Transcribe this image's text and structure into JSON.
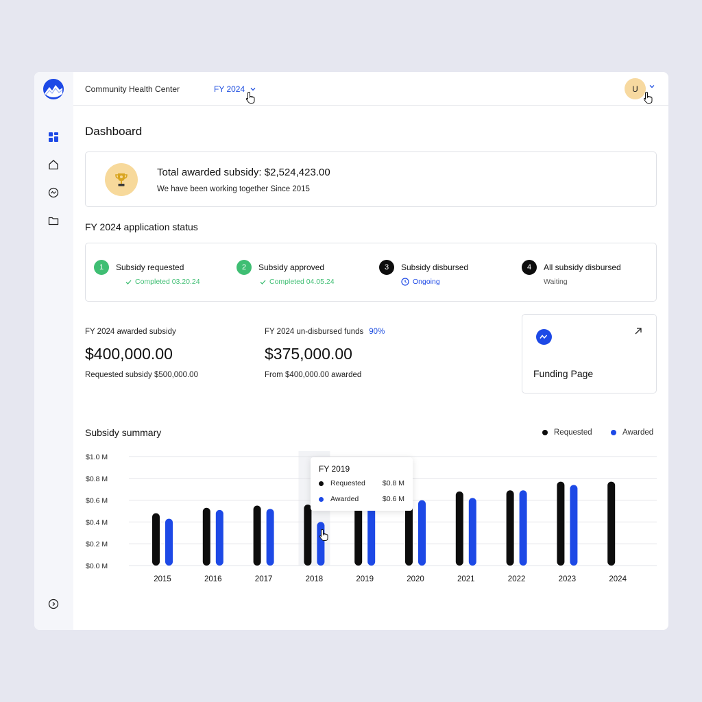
{
  "header": {
    "org_name": "Community Health Center",
    "fy_selected": "FY 2024",
    "avatar_initial": "U"
  },
  "sidebar": {
    "items": [
      {
        "icon": "dashboard-icon"
      },
      {
        "icon": "home-icon"
      },
      {
        "icon": "activity-icon"
      },
      {
        "icon": "folder-icon"
      }
    ],
    "bottom_icon": "expand-icon"
  },
  "page_title": "Dashboard",
  "total_card": {
    "title": "Total awarded subsidy: $2,524,423.00",
    "subtitle": "We have been working together Since 2015",
    "icon": "trophy-icon"
  },
  "application_status": {
    "title": "FY 2024 application status",
    "steps": [
      {
        "number": "1",
        "title": "Subsidy requested",
        "status": "Completed 03.20.24",
        "state": "completed"
      },
      {
        "number": "2",
        "title": "Subsidy approved",
        "status": "Completed 04.05.24",
        "state": "completed"
      },
      {
        "number": "3",
        "title": "Subsidy disbursed",
        "status": "Ongoing",
        "state": "ongoing"
      },
      {
        "number": "4",
        "title": "All subsidy disbursed",
        "status": "Waiting",
        "state": "waiting"
      }
    ]
  },
  "stats": {
    "awarded": {
      "label": "FY 2024 awarded subsidy",
      "value": "$400,000.00",
      "sub": "Requested subsidy $500,000.00"
    },
    "undisbursed": {
      "label": "FY 2024 un-disbursed funds",
      "percent": "90%",
      "value": "$375,000.00",
      "sub": "From $400,000.00 awarded"
    }
  },
  "funding_card": {
    "title": "Funding Page"
  },
  "summary": {
    "title": "Subsidy summary",
    "legend": {
      "requested": "Requested",
      "awarded": "Awarded"
    },
    "tooltip": {
      "title": "FY 2019",
      "requested_label": "Requested",
      "requested_value": "$0.8 M",
      "awarded_label": "Awarded",
      "awarded_value": "$0.6 M"
    }
  },
  "colors": {
    "requested": "#0d0d0d",
    "awarded": "#1d49e6",
    "completed": "#3fbe73",
    "ongoing": "#1d49e6",
    "accent": "#1f4fe0"
  },
  "chart_data": {
    "type": "bar",
    "categories": [
      "2015",
      "2016",
      "2017",
      "2018",
      "2019",
      "2020",
      "2021",
      "2022",
      "2023",
      "2024"
    ],
    "series": [
      {
        "name": "Requested",
        "values": [
          0.48,
          0.53,
          0.55,
          0.56,
          0.8,
          0.6,
          0.68,
          0.69,
          0.77,
          0.77
        ]
      },
      {
        "name": "Awarded",
        "values": [
          0.43,
          0.51,
          0.52,
          0.4,
          0.6,
          0.6,
          0.62,
          0.69,
          0.74,
          null
        ]
      }
    ],
    "y_ticks": [
      "$0.0 M",
      "$0.2 M",
      "$0.4 M",
      "$0.6 M",
      "$0.8 M",
      "$1.0 M"
    ],
    "ylim": [
      0,
      1.0
    ],
    "grid": true,
    "legend": "top-right",
    "highlighted_category": "2018"
  }
}
